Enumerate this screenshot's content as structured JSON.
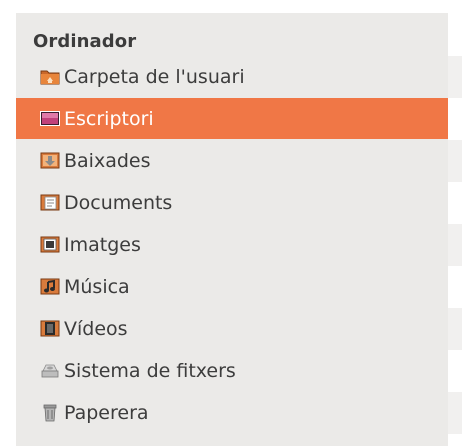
{
  "sidebar": {
    "section_title": "Ordinador",
    "items": [
      {
        "label": "Carpeta de l'usuari",
        "icon": "home-folder-icon",
        "selected": false
      },
      {
        "label": "Escriptori",
        "icon": "desktop-folder-icon",
        "selected": true
      },
      {
        "label": "Baixades",
        "icon": "downloads-folder-icon",
        "selected": false
      },
      {
        "label": "Documents",
        "icon": "documents-folder-icon",
        "selected": false
      },
      {
        "label": "Imatges",
        "icon": "pictures-folder-icon",
        "selected": false
      },
      {
        "label": "Música",
        "icon": "music-folder-icon",
        "selected": false
      },
      {
        "label": "Vídeos",
        "icon": "videos-folder-icon",
        "selected": false
      },
      {
        "label": "Sistema de fitxers",
        "icon": "filesystem-drive-icon",
        "selected": false
      },
      {
        "label": "Paperera",
        "icon": "trash-icon",
        "selected": false
      }
    ]
  },
  "colors": {
    "selection": "#f07746",
    "sidebar_bg": "#ebeae8",
    "text": "#3c3c3c"
  }
}
